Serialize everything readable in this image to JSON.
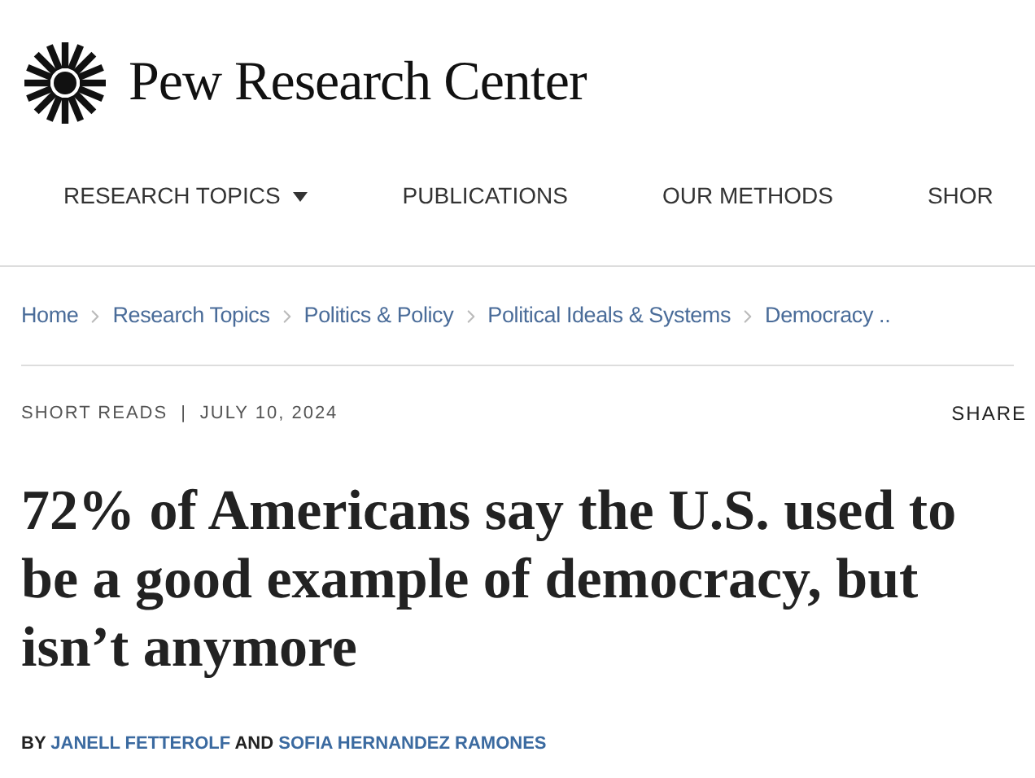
{
  "brand": {
    "name": "Pew Research Center"
  },
  "nav": [
    {
      "label": "RESEARCH TOPICS",
      "dropdown": true
    },
    {
      "label": "PUBLICATIONS",
      "dropdown": false
    },
    {
      "label": "OUR METHODS",
      "dropdown": false
    },
    {
      "label": "SHOR",
      "dropdown": false
    }
  ],
  "breadcrumbs": [
    "Home",
    "Research Topics",
    "Politics & Policy",
    "Political Ideals & Systems",
    "Democracy .."
  ],
  "meta": {
    "category": "SHORT READS",
    "separator": "|",
    "date": "JULY 10, 2024",
    "share": "SHARE"
  },
  "headline": "72% of Americans say the U.S. used to be a good example of democracy, but isn’t anymore",
  "byline": [
    {
      "kind": "text",
      "text": "BY"
    },
    {
      "kind": "link",
      "text": "JANELL FETTEROLF"
    },
    {
      "kind": "text",
      "text": "AND"
    },
    {
      "kind": "link",
      "text": "SOFIA HERNANDEZ RAMONES"
    }
  ]
}
